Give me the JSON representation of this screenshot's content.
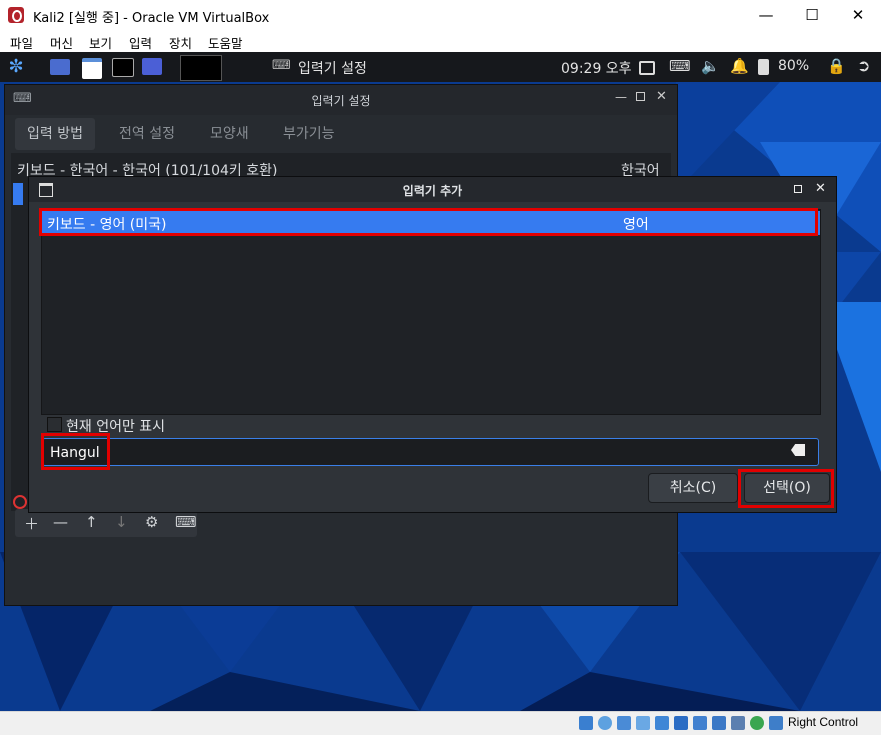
{
  "window": {
    "title": "Kali2 [실행 중] - Oracle VM VirtualBox"
  },
  "menubar": {
    "items": [
      "파일",
      "머신",
      "보기",
      "입력",
      "장치",
      "도움말"
    ]
  },
  "panel": {
    "app_label": "입력기 설정",
    "clock": "09:29 오후",
    "battery": "80%"
  },
  "settings": {
    "title": "입력기 설정",
    "tabs": [
      "입력 방법",
      "전역 설정",
      "모양새",
      "부가기능"
    ],
    "list": [
      {
        "name": "키보드 - 한국어 - 한국어 (101/104키 호환)",
        "lang": "한국어"
      }
    ]
  },
  "add_dialog": {
    "title": "입력기 추가",
    "items": [
      {
        "name": "키보드 - 영어 (미국)",
        "lang": "영어"
      }
    ],
    "only_current_label": "현재 언어만 표시",
    "search_value": "Hangul",
    "cancel_label": "취소(C)",
    "select_label": "선택(O)"
  },
  "statusbar": {
    "host_key": "Right Control"
  },
  "colors": {
    "accent": "#367bf0",
    "highlight": "#e20000",
    "panel_bg": "#16181c",
    "window_bg": "#272b30"
  }
}
